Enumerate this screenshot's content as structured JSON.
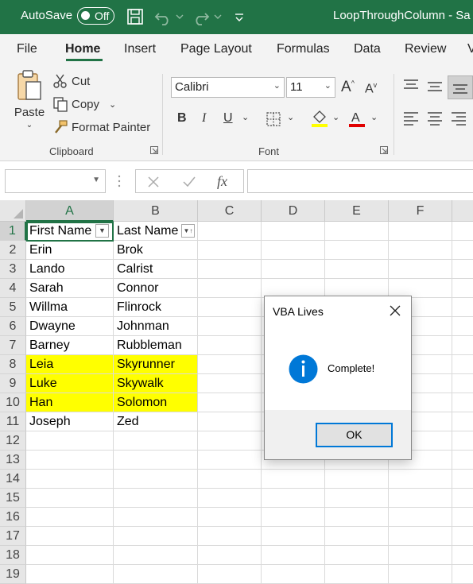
{
  "titlebar": {
    "autosave_label": "AutoSave",
    "autosave_state": "Off",
    "title": "LoopThroughColumn - Sa"
  },
  "tabs": [
    "File",
    "Home",
    "Insert",
    "Page Layout",
    "Formulas",
    "Data",
    "Review",
    "V"
  ],
  "active_tab": "Home",
  "ribbon": {
    "clipboard": {
      "paste": "Paste",
      "cut": "Cut",
      "copy": "Copy",
      "format_painter": "Format Painter",
      "label": "Clipboard"
    },
    "font": {
      "name": "Calibri",
      "size": "11",
      "bold": "B",
      "italic": "I",
      "underline": "U",
      "label": "Font"
    }
  },
  "formula_bar": {
    "fx": "fx"
  },
  "sheet": {
    "columns": [
      "A",
      "B",
      "C",
      "D",
      "E",
      "F"
    ],
    "rows": [
      "1",
      "2",
      "3",
      "4",
      "5",
      "6",
      "7",
      "8",
      "9",
      "10",
      "11",
      "12",
      "13",
      "14",
      "15",
      "16",
      "17",
      "18",
      "19"
    ],
    "data": [
      [
        "First Name",
        "Last Name"
      ],
      [
        "Erin",
        "Brok"
      ],
      [
        "Lando",
        "Calrist"
      ],
      [
        "Sarah",
        "Connor"
      ],
      [
        "Willma",
        "Flinrock"
      ],
      [
        "Dwayne",
        "Johnman"
      ],
      [
        "Barney",
        "Rubbleman"
      ],
      [
        "Leia",
        "Skyrunner"
      ],
      [
        "Luke",
        "Skywalk"
      ],
      [
        "Han",
        "Solomon"
      ],
      [
        "Joseph",
        "Zed"
      ]
    ],
    "highlight_rows": [
      8,
      9,
      10
    ],
    "highlight_color": "#ffff00"
  },
  "dialog": {
    "title": "VBA Lives",
    "message": "Complete!",
    "ok_label": "OK"
  },
  "colors": {
    "excel_green": "#217346",
    "info_blue": "#0078d7"
  }
}
